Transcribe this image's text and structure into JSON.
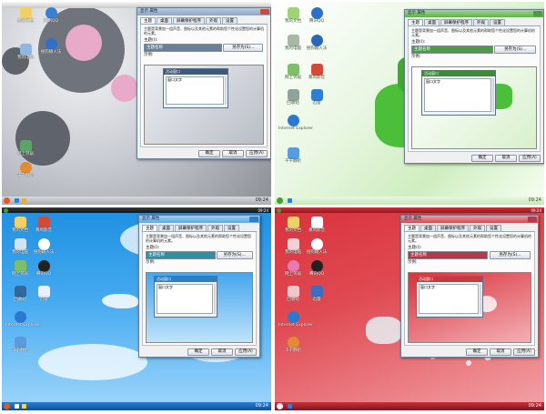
{
  "dialog": {
    "title": "显示 属性",
    "tabs": [
      "主题",
      "桌面",
      "屏幕保护程序",
      "外观",
      "设置"
    ],
    "description": "主题是背景加一组声音、图标以及其他元素的帮助您个性化设置您的计算机的元素。",
    "theme_label": "主题(I):",
    "theme_value": "主题名称",
    "save_as_label": "另存为(S)...",
    "delete_label": "删除(D)",
    "sample_label": "示例:",
    "sample_window_title": "活动窗口",
    "sample_window_text": "窗口文字",
    "ok_label": "确定",
    "cancel_label": "取消",
    "apply_label": "应用(A)"
  },
  "desktop_icons": {
    "my_documents": "我的文档",
    "computer": "我的电脑",
    "network": "网上邻居",
    "recycle": "回收站",
    "ie": "Internet Explorer",
    "qq": "腾讯QQ",
    "sogou": "搜狗输入法",
    "media": "暴风影音",
    "storm": "迅雷",
    "player": "千千静听"
  },
  "clock": "09:24",
  "variants": [
    {
      "name": "grey",
      "accent": "#3d5a7a",
      "select_color": "#6b7f99"
    },
    {
      "name": "green",
      "accent": "#3f8a3a",
      "select_color": "#4f9a48"
    },
    {
      "name": "blue",
      "accent": "#2b7fc4",
      "select_color": "#2f8fa0"
    },
    {
      "name": "red",
      "accent": "#c23a44",
      "select_color": "#b7384a"
    }
  ]
}
